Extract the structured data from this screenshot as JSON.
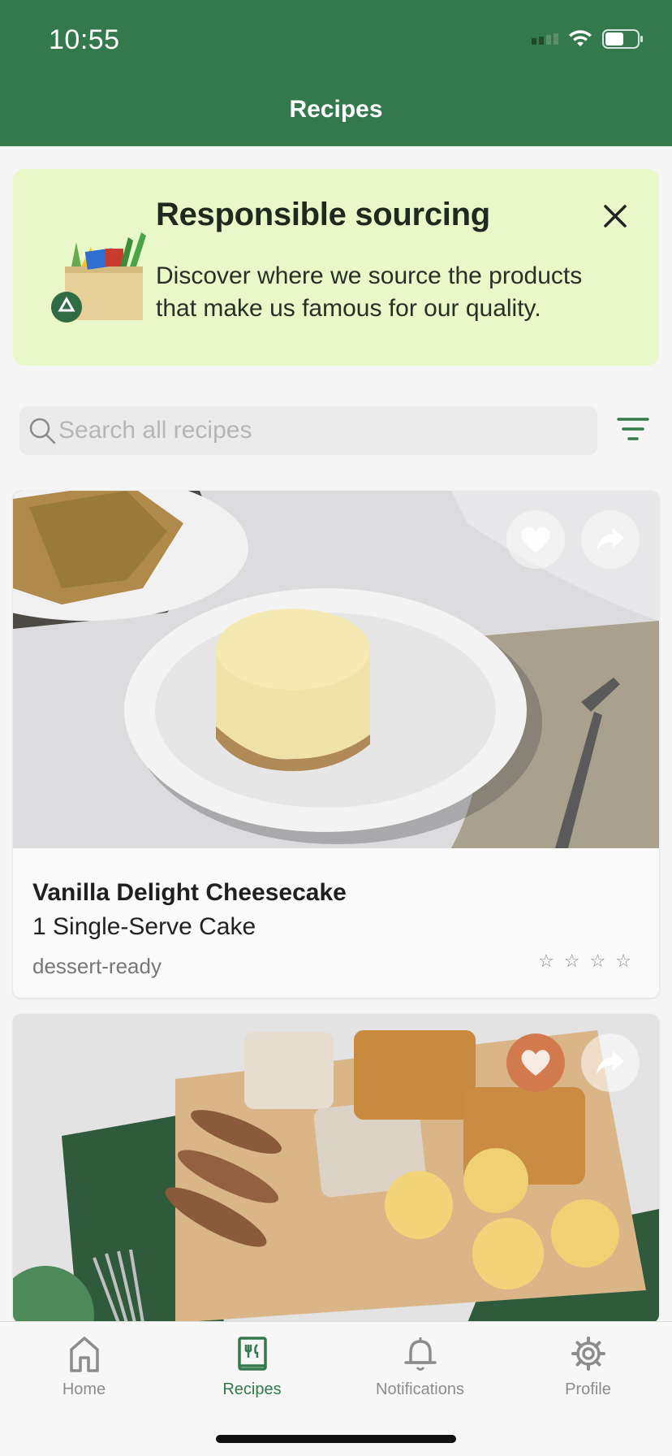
{
  "status_bar": {
    "time": "10:55"
  },
  "header": {
    "title": "Recipes",
    "background": "#34794b"
  },
  "banner": {
    "title": "Responsible sourcing",
    "description": "Discover where we source the products that make us famous for our quality.",
    "close_icon": "close-icon",
    "illustration_icon": "grocery-bag-recycle-icon",
    "background": "#e9f8c9"
  },
  "search": {
    "placeholder": "Search all recipes",
    "value": "",
    "icon": "search-icon",
    "filter_icon": "filter-icon"
  },
  "recipes": [
    {
      "title": "Vanilla Delight Cheesecake",
      "serving": "1 Single-Serve Cake",
      "tag": "dessert-ready",
      "rating_stars": 0,
      "rating_max": 4,
      "favorited": false,
      "image": "cheesecake-photo"
    },
    {
      "title": "",
      "favorited": true,
      "image": "brunch-board-photo"
    }
  ],
  "bottom_nav": {
    "items": [
      {
        "label": "Home",
        "icon": "home-icon",
        "active": false
      },
      {
        "label": "Recipes",
        "icon": "recipe-book-icon",
        "active": true
      },
      {
        "label": "Notifications",
        "icon": "bell-icon",
        "active": false
      },
      {
        "label": "Profile",
        "icon": "gear-icon",
        "active": false
      }
    ]
  },
  "colors": {
    "accent": "#34794b",
    "favorite_active": "#d27a4e",
    "banner": "#e9f8c9"
  }
}
